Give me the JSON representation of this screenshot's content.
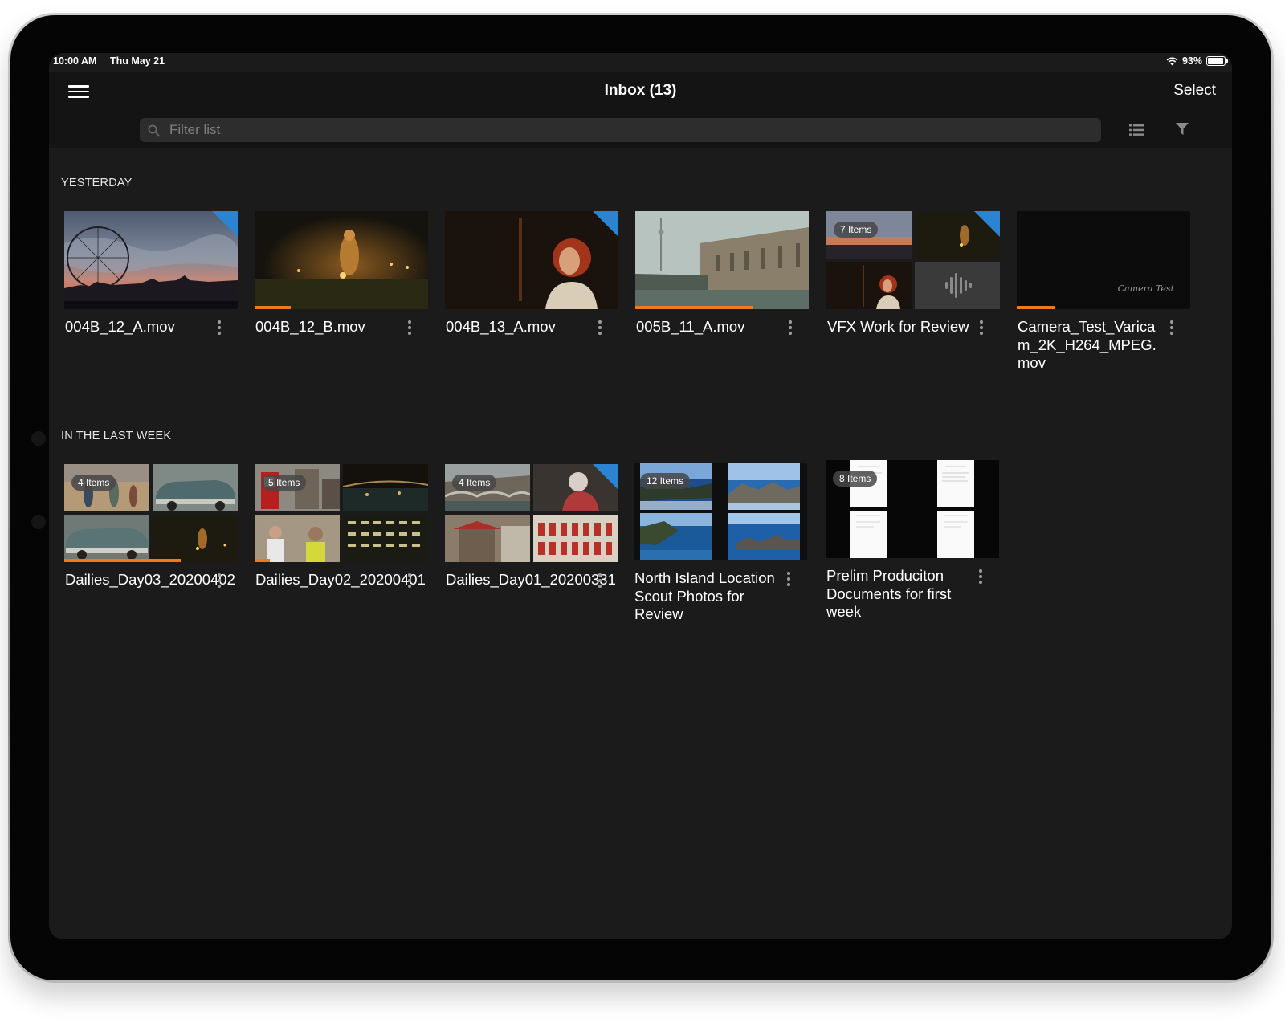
{
  "status_bar": {
    "time": "10:00 AM",
    "date": "Thu May 21",
    "battery": "93%",
    "battery_level": 0.93
  },
  "nav": {
    "title": "Inbox (13)",
    "select_label": "Select"
  },
  "search": {
    "placeholder": "Filter list"
  },
  "sections": {
    "yesterday": {
      "title": "YESTERDAY",
      "items": [
        {
          "title": "004B_12_A.mov",
          "progress": 0,
          "flagged": true
        },
        {
          "title": "004B_12_B.mov",
          "progress": 0.21,
          "flagged": false
        },
        {
          "title": "004B_13_A.mov",
          "progress": 0,
          "flagged": true
        },
        {
          "title": "005B_11_A.mov",
          "progress": 0.68,
          "flagged": false
        },
        {
          "title": "VFX Work for Review",
          "badge": "7 Items",
          "flagged": true
        },
        {
          "title": "Camera_Test_Varicam_2K_H264_MPEG.mov",
          "progress": 0.22,
          "flagged": false,
          "watermark": "Camera Test"
        }
      ]
    },
    "last_week": {
      "title": "IN THE LAST WEEK",
      "items": [
        {
          "title": "Dailies_Day03_20200402",
          "badge": "4 Items",
          "progress": 0.67
        },
        {
          "title": "Dailies_Day02_20200401",
          "badge": "5 Items",
          "progress": 0.09
        },
        {
          "title": "Dailies_Day01_20200331",
          "badge": "4 Items",
          "flagged": true
        },
        {
          "title": "North Island Location Scout Photos for Review",
          "badge": "12 Items"
        },
        {
          "title": "Prelim Produciton Documents for first week",
          "badge": "8 Items"
        }
      ]
    }
  },
  "colors": {
    "accent_orange": "#f07a1a",
    "flag_blue": "#2a84d2",
    "background": "#1b1b1b",
    "navbar": "#141414"
  },
  "icons": [
    "hamburger-menu-icon",
    "search-icon",
    "list-view-icon",
    "filter-icon",
    "more-vertical-icon",
    "wifi-icon",
    "battery-icon",
    "audio-waveform-icon"
  ]
}
